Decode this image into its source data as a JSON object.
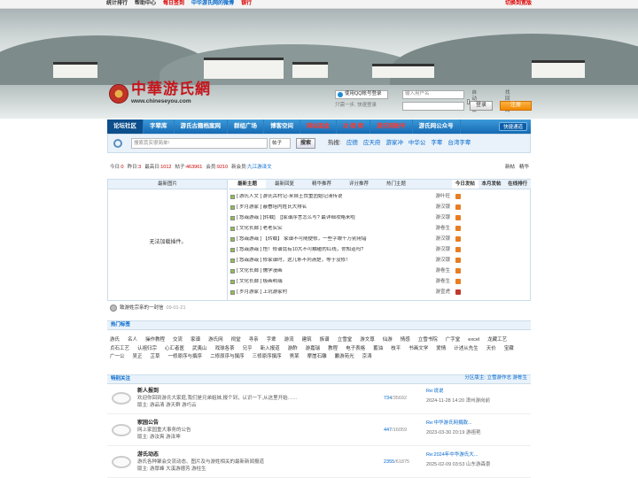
{
  "topbar": {
    "links": [
      {
        "label": "统计排行",
        "style": "normal"
      },
      {
        "label": "帮助中心",
        "style": "normal"
      },
      {
        "label": "每日签到",
        "style": "red"
      },
      {
        "label": "中华游氏网的微博",
        "style": "blue"
      },
      {
        "label": "银行",
        "style": "red"
      }
    ],
    "switch_label": "切换到宽版"
  },
  "logo": {
    "cn": "中華游氏網",
    "en": "www.chineseyou.com"
  },
  "login": {
    "qq_label": "使用QQ帐号登录",
    "tip": "只需一步, 快速登录",
    "user_placeholder": "输入用户名",
    "auto_login": "自动登录",
    "find_pwd": "找回密码",
    "login_btn": "登录",
    "register_btn": "注册"
  },
  "nav": {
    "items": [
      {
        "label": "论坛社区",
        "style": "first"
      },
      {
        "label": "字辈库",
        "style": ""
      },
      {
        "label": "游氏古籍档案网",
        "style": ""
      },
      {
        "label": "群组广场",
        "style": ""
      },
      {
        "label": "博客空间",
        "style": ""
      },
      {
        "label": "网站基金",
        "style": "hl"
      },
      {
        "label": "功 德 榜",
        "style": "hl"
      },
      {
        "label": "游氏网账号",
        "style": "hl"
      },
      {
        "label": "游氏网公众号",
        "style": ""
      }
    ],
    "quick": "快捷通道"
  },
  "search": {
    "placeholder": "搜索其实很简单!",
    "type": "帖子",
    "button": "搜索",
    "hot_label": "热搜:",
    "hot_keywords": [
      "应德",
      "应天府",
      "游家冲",
      "中华公",
      "字辈",
      "台湾字辈"
    ]
  },
  "stats": {
    "today_l": "今日:",
    "today": "0",
    "yesterday_l": "昨日:",
    "yesterday": "3",
    "max_l": "最高日:",
    "max": "1012",
    "posts_l": "帖子:",
    "posts": "463961",
    "members_l": "会员:",
    "members": "9210",
    "newest_l": "新会员:",
    "newest": "九江游泽文",
    "right": [
      "新帖",
      "精华"
    ]
  },
  "grid": {
    "img_title": "最新图片",
    "no_plugin": "无法加载插件。",
    "tabs": [
      "最新主题",
      "最新回复",
      "精华推荐",
      "评分推荐",
      "热门主题"
    ],
    "rank_tabs": [
      "今日发帖",
      "本月发帖",
      "在线排行"
    ],
    "topics": [
      {
        "title": "[ 游氏人文 ] 游氏古村记-来自土饺重团始记清传说",
        "author": "游叶旺",
        "mark": "#8bc34a"
      },
      {
        "title": "[ 岁月游家 ] 蔽眷培内姓氏大排名",
        "author": "游汉银",
        "mark": "#8bc34a"
      },
      {
        "title": "[ 悠哉游哉 ] [转载]　[]家谱序言怎么写? 最详细攻略来啦",
        "author": "游汉银",
        "mark": "#8bc34a"
      },
      {
        "title": "[ 文化长廊 ] 老老实实",
        "author": "游卷生",
        "mark": "#8bc34a"
      },
      {
        "title": "[ 悠哉游哉 ] 【转载】 家谱不可随便修，一些字眼千万别用错",
        "author": "游汉银",
        "mark": "#8bc34a"
      },
      {
        "title": "[ 悠哉游哉 ] 悟！修谱竟有10大不可触碰的红线，你知道吗?",
        "author": "游汉银",
        "mark": "#8bc34a"
      },
      {
        "title": "[ 悠哉游哉 ] 修家谱时，这几条不列清楚，等于没修！",
        "author": "游汉银",
        "mark": "#8bc34a"
      },
      {
        "title": "[ 文化长廊 ] 儒学漫画",
        "author": "游卷生",
        "mark": "#8bc34a"
      },
      {
        "title": "[ 文化长廊 ] 极画明瑞",
        "author": "游卷生",
        "mark": "#8bc34a"
      },
      {
        "title": "[ 岁月游家 ] 上坑游家村",
        "author": "游宣虎",
        "mark": "#8bc34a"
      }
    ],
    "rank_colors": [
      "#e67e22",
      "#e67e22",
      "#e67e22",
      "#e67e22",
      "#e67e22",
      "#e67e22",
      "#e67e22",
      "#e67e22",
      "#e67e22",
      "#c0392b"
    ]
  },
  "letter": {
    "text": "致游姓宗亲的一封信",
    "date": "09-01-21"
  },
  "tags_section": {
    "title": "热门标签",
    "tags": [
      "游氏",
      "名人",
      "操作教程",
      "交流",
      "家谱",
      "游氏网",
      "祠堂",
      "寻亲",
      "字辈",
      "游流",
      "建筑",
      "族谱",
      "立雪堂",
      "游文尊",
      "仙游",
      "情感",
      "立雪书院",
      "广字堂",
      "excel",
      "龙藏工艺",
      "贞石工艺",
      "认祖归宗",
      "心汇者医",
      "武夷山",
      "戏球各茶",
      "兄乎",
      "新入报道",
      "游酢",
      "游嘉瑞",
      "教程",
      "电子表格",
      "蓄油",
      "枝平",
      "书画文学",
      "爱情",
      "计述从先生",
      "天价",
      "宝藏",
      "广一公",
      "吴正",
      "芷草",
      "一修原序与撰序",
      "二修原序与撰序",
      "三修原序撰序",
      "男某",
      "摩崖石雕",
      "麝游苑光",
      "京涛"
    ]
  },
  "featured": {
    "title": "特别关注",
    "mods": "分区版主: 立雪游作志 游栋生",
    "forums": [
      {
        "name": "新人报到",
        "desc": "欢迎你回到游氏大家庭,我们是兄弟姐妹,报个到，认识一下,从这里开始……",
        "mods": "版主: 游品清 游天群 游巧云",
        "count_a": "734",
        "count_b": "35692",
        "last": "Re:说说",
        "last_time": "2024-11-28 14:20 漳州游岗前"
      },
      {
        "name": "家园公告",
        "desc": "网上家园重大事务的公告",
        "mods": "版主: 游汝爽 游泽坤",
        "count_a": "447",
        "count_b": "16059",
        "last": "Re:中华游氏网捐款...",
        "last_time": "2023-03-30 20:19 游祖艳"
      },
      {
        "name": "游氏动态",
        "desc": "游氏各种聚会交流动态、图片及与游姓相关的最新新闻报道",
        "mods": "版主: 游厚峰 大溪游德芳 游柱生",
        "count_a": "2355",
        "count_b": "61875",
        "last": "Re:2024年中华游氏大...",
        "last_time": "2025-02-09 03:53 山东游森景"
      }
    ]
  }
}
